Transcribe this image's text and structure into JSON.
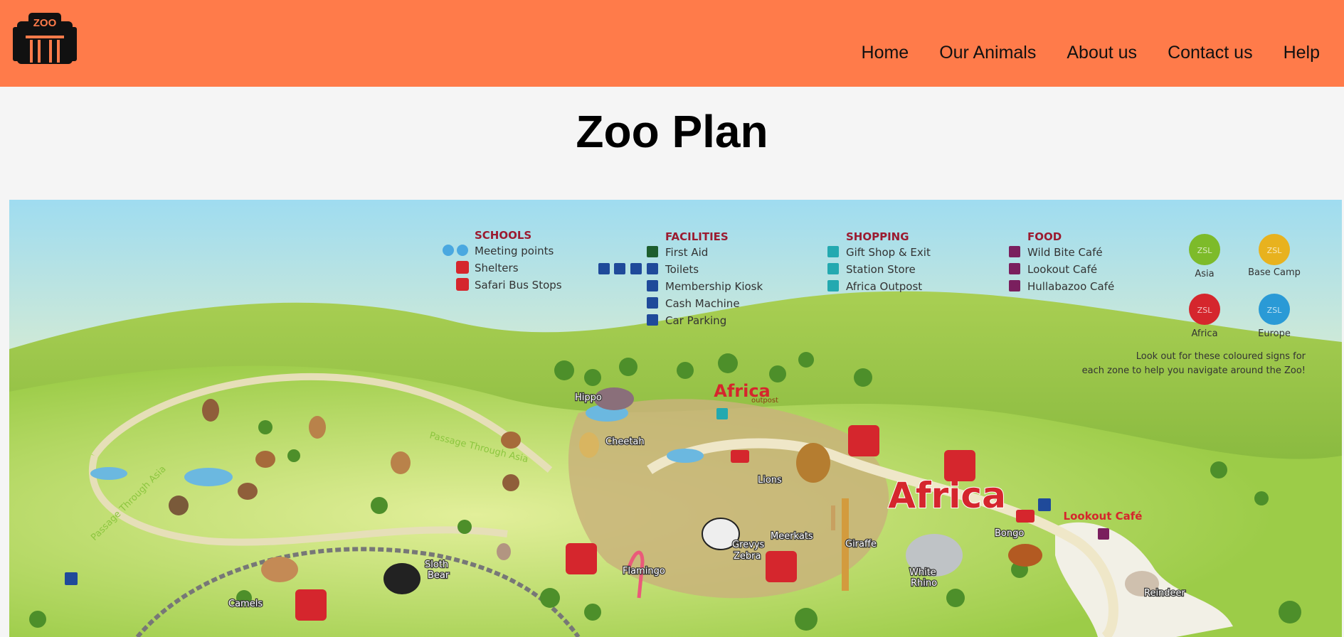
{
  "header": {
    "logo_text": "ZOO",
    "nav": [
      "Home",
      "Our Animals",
      "About us",
      "Contact us",
      "Help"
    ]
  },
  "page": {
    "title": "Zoo Plan"
  },
  "map": {
    "legend": {
      "schools": {
        "title": "SCHOOLS",
        "items": [
          "Meeting points",
          "Shelters",
          "Safari Bus Stops"
        ]
      },
      "facilities": {
        "title": "FACILITIES",
        "items": [
          "First Aid",
          "Toilets",
          "Membership Kiosk",
          "Cash Machine",
          "Car Parking"
        ]
      },
      "shopping": {
        "title": "SHOPPING",
        "items": [
          "Gift Shop & Exit",
          "Station Store",
          "Africa Outpost"
        ]
      },
      "food": {
        "title": "FOOD",
        "items": [
          "Wild Bite Café",
          "Lookout Café",
          "Hullabazoo Café"
        ]
      }
    },
    "zones": [
      "Asia",
      "Base Camp",
      "Africa",
      "Europe"
    ],
    "zone_badge": "ZSL",
    "zone_note_1": "Look out for these coloured signs for",
    "zone_note_2": "each zone to help you navigate around the Zoo!",
    "area_title": "Africa",
    "outpost_1": "Africa",
    "outpost_2": "outpost",
    "lookout": "Lookout Café",
    "path_1": "Passage Through Asia",
    "path_2": "Passage Through Asia",
    "animals": [
      "Hippo",
      "Cheetah",
      "Lions",
      "Meerkats",
      "Giraffe",
      "Grevys",
      "Zebra",
      "White",
      "Rhino",
      "Bongo",
      "Reindeer",
      "Flamingo",
      "Sloth",
      "Bear",
      "Camels"
    ],
    "colors": {
      "header": "#ff7b4a",
      "legend_title": "#9b1b30",
      "asia": "#7dbb2a",
      "basecamp": "#e8b21e",
      "africa": "#d5262d",
      "europe": "#2a9ad6"
    }
  }
}
